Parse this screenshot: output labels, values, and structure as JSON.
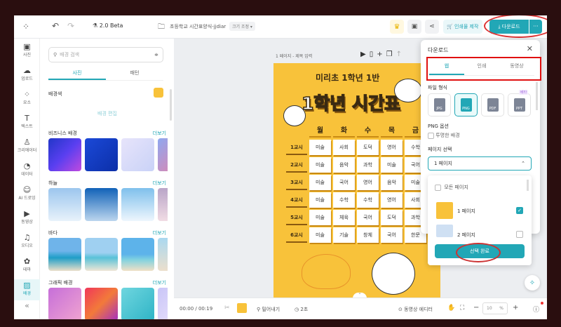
{
  "topbar": {
    "version": "2.0 Beta",
    "doc_title": "초등학교 시간표양식-jjdiar",
    "resize_label": "크기 조정",
    "print_label": "인쇄물 제작",
    "download_label": "다운로드",
    "more": "···"
  },
  "rail": [
    {
      "label": "사진",
      "icon": "image-icon",
      "g": "▣"
    },
    {
      "label": "업로드",
      "icon": "upload-icon",
      "g": "☁"
    },
    {
      "label": "요소",
      "icon": "elements-icon",
      "g": "⁘"
    },
    {
      "label": "텍스트",
      "icon": "text-icon",
      "g": "T"
    },
    {
      "label": "크리에이터",
      "icon": "creator-icon",
      "g": "♙"
    },
    {
      "label": "데이터",
      "icon": "chart-icon",
      "g": "◔"
    },
    {
      "label": "AI 드로잉",
      "icon": "ai-icon",
      "g": "☺"
    },
    {
      "label": "동영상",
      "icon": "video-icon",
      "g": "▶"
    },
    {
      "label": "오디오",
      "icon": "music-icon",
      "g": "♫"
    },
    {
      "label": "테마",
      "icon": "palette-icon",
      "g": "✿"
    },
    {
      "label": "배경",
      "icon": "background-icon",
      "g": "▨"
    }
  ],
  "panel": {
    "search_placeholder": "배경 검색",
    "tabs": [
      "사진",
      "패턴"
    ],
    "bg_color_label": "배경색",
    "bg_color": "#f8c23a",
    "bg_edit": "배경 편집",
    "more": "더보기",
    "sections": [
      {
        "title": "비즈니스 배경",
        "thumbs": [
          "linear-gradient(135deg,#2136c8,#5a3ff0,#c04adf)",
          "linear-gradient(135deg,#1b49d8,#0c2fa8)",
          "linear-gradient(135deg,#e7e4fb,#c9d2f7)",
          "linear-gradient(135deg,#8ea8f0,#f07ea0)"
        ]
      },
      {
        "title": "하늘",
        "thumbs": [
          "linear-gradient(#9cc6ee,#e8f2fb)",
          "linear-gradient(#1162b8,#bcd6ee)",
          "linear-gradient(#7fc0ec,#eef6fd)",
          "linear-gradient(#b9a5c8,#f1dce4)"
        ]
      },
      {
        "title": "바다",
        "thumbs": [
          "linear-gradient(#6fb4ea 40%,#1f9ec7 60%,#eadfc9)",
          "linear-gradient(#9fd0f1 45%,#59c2d8 60%,#efe6d6)",
          "linear-gradient(#5db3ea 50%,#7fd1e0 65%,#f0e0c6)",
          "linear-gradient(#a9d8f0,#ecdfcc)"
        ]
      },
      {
        "title": "그래픽 배경",
        "thumbs": [
          "linear-gradient(135deg,#c66fd9,#f0a3d0)",
          "linear-gradient(135deg,#f0375a,#f27a3a,#a52fc0)",
          "linear-gradient(135deg,#6fd6df,#2fb4c6)",
          "linear-gradient(135deg,#c9c6f8,#efe5fb)"
        ]
      }
    ]
  },
  "canvas": {
    "page_label": "1 페이지 - 제목 입력",
    "subtitle": "미리초 1학년 1반",
    "title": "1학년 시간표",
    "days": [
      "월",
      "화",
      "수",
      "목",
      "금"
    ],
    "rows": [
      {
        "p": "1교시",
        "s": [
          "미술",
          "사회",
          "도덕",
          "영어",
          "수학"
        ]
      },
      {
        "p": "2교시",
        "s": [
          "미술",
          "음악",
          "과학",
          "미술",
          "국어"
        ]
      },
      {
        "p": "3교시",
        "s": [
          "미술",
          "국어",
          "영어",
          "음악",
          "미술"
        ]
      },
      {
        "p": "4교시",
        "s": [
          "미술",
          "수학",
          "수학",
          "영어",
          "사회"
        ]
      },
      {
        "p": "5교시",
        "s": [
          "미술",
          "체육",
          "국어",
          "도덕",
          "과학"
        ]
      },
      {
        "p": "6교시",
        "s": [
          "미술",
          "기술",
          "창체",
          "국어",
          "한문"
        ]
      }
    ]
  },
  "bottom": {
    "time": "00:00 / 00:19",
    "extract": "밀어내기",
    "duration": "2초",
    "video_editor": "동영상 에디터",
    "zoom": "10",
    "zoom_unit": "%"
  },
  "dialog": {
    "title": "다운로드",
    "tabs": [
      "웹",
      "인쇄",
      "동영상"
    ],
    "file_format": "파일 형식",
    "formats": [
      "JPG",
      "PNG",
      "PDF",
      "PPT"
    ],
    "beta": "베타",
    "png_options": "PNG 옵션",
    "transparent": "투명한 배경",
    "page_select": "페이지 선택",
    "selected": "1 페이지",
    "all_pages": "모든 페이지",
    "pages": [
      "1 페이지",
      "2 페이지"
    ],
    "confirm": "선택 완료"
  }
}
